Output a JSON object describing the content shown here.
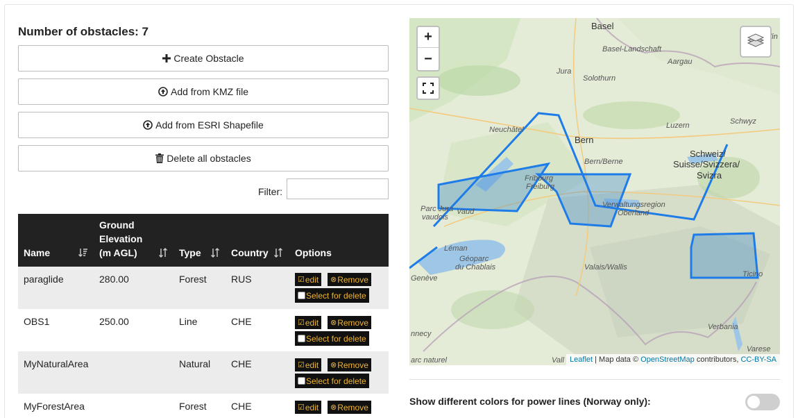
{
  "header": {
    "obstacle_count_label": "Number of obstacles: 7"
  },
  "actions": {
    "create": "Create Obstacle",
    "add_kmz": "Add from KMZ file",
    "add_shapefile": "Add from ESRI Shapefile",
    "delete_all": "Delete all obstacles"
  },
  "filter": {
    "label": "Filter:",
    "value": ""
  },
  "table": {
    "columns": [
      "Name",
      "Ground Elevation (m AGL)",
      "Type",
      "Country",
      "Options"
    ],
    "column_lines": {
      "elev_1": "Ground",
      "elev_2": "Elevation",
      "elev_3": "(m AGL)"
    },
    "rows": [
      {
        "name": "paraglide",
        "elevation": "280.00",
        "type": "Forest",
        "country": "RUS"
      },
      {
        "name": "OBS1",
        "elevation": "250.00",
        "type": "Line",
        "country": "CHE"
      },
      {
        "name": "MyNaturalArea",
        "elevation": "",
        "type": "Natural",
        "country": "CHE"
      },
      {
        "name": "MyForestArea",
        "elevation": "",
        "type": "Forest",
        "country": "CHE"
      }
    ],
    "option_labels": {
      "edit": "edit",
      "remove": "Remove",
      "select": "Select for delete"
    }
  },
  "map": {
    "zoom_in": "+",
    "zoom_out": "−",
    "labels": {
      "basel": "Basel",
      "basel_landschaft": "Basel-Landschaft",
      "aargau": "Aargau",
      "jura": "Jura",
      "solothurn": "Solothurn",
      "neuchatel": "Neuchâtel",
      "bern": "Bern",
      "bern_berne": "Bern/Berne",
      "luzern": "Luzern",
      "schwyz": "Schwyz",
      "schweiz": "Schweiz/",
      "suisse": "Suisse/Svizzera/",
      "svizra": "Svizra",
      "fribourg": "Fribourg",
      "freiburg": "Freiburg",
      "vaud": "Vaud",
      "parc_jura": "Parc Jura",
      "vaudois": "vaudois",
      "leman": "Léman",
      "geoparc": "Géoparc",
      "chablais": "du Chablais",
      "geneve": "Genève",
      "verwaltungsregion": "Verwaltungsregion",
      "oberland": "Oberland",
      "valais": "Valais/Wallis",
      "ticino": "Ticino",
      "verbania": "Verbania",
      "varese": "Varese",
      "annecy": "nnecy",
      "parc_naturel": "arc naturel",
      "win": "Win",
      "vall": "Vall"
    },
    "attribution": {
      "leaflet": "Leaflet",
      "data_prefix": " | Map data © ",
      "osm": "OpenStreetMap",
      "contrib": " contributors, ",
      "license": "CC-BY-SA"
    },
    "colors": {
      "obstacle_stroke": "#1e7ce8",
      "obstacle_fill": "#3a88d0"
    }
  },
  "settings": {
    "power_lines_label": "Show different colors for power lines (Norway only):",
    "power_lines_enabled": false
  }
}
